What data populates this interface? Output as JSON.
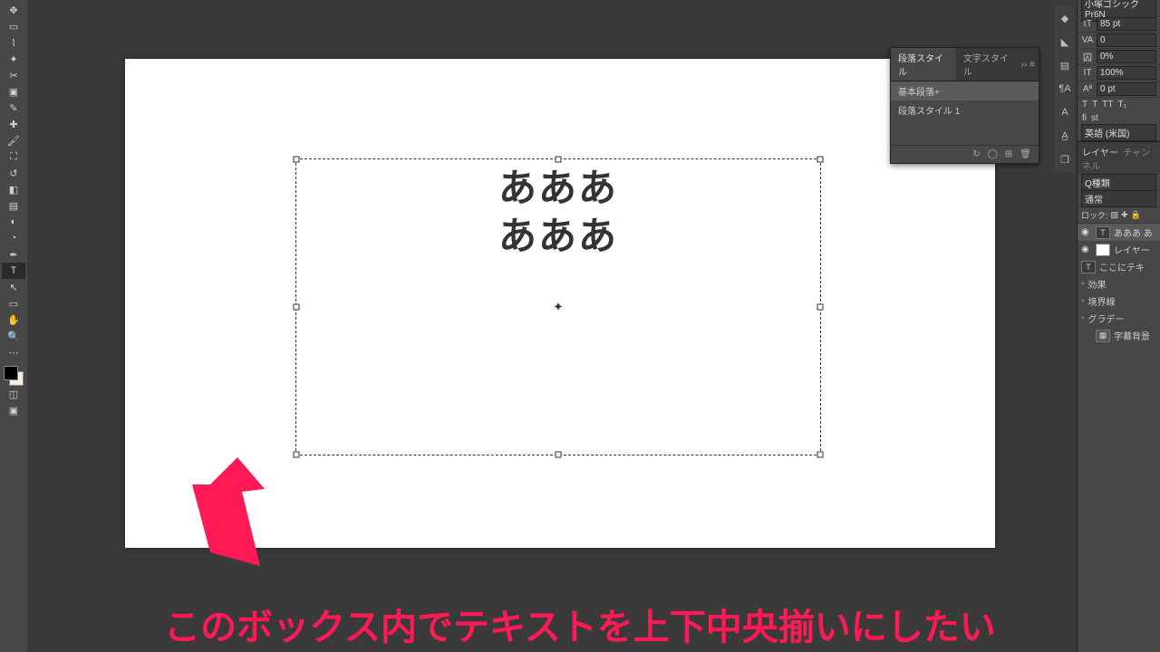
{
  "canvas": {
    "text_line1": "あああ",
    "text_line2": "あああ"
  },
  "paragraph_panel": {
    "tab1": "段落スタイル",
    "tab2": "文字スタイル",
    "item1": "基本段落+",
    "item2": "段落スタイル 1"
  },
  "char": {
    "font": "小塚ゴシック Pr6N",
    "size": "85 pt",
    "va": "0",
    "a_pct": "0%",
    "scale": "100%",
    "baseline": "0 pt",
    "lang": "英語 (米国)"
  },
  "type_row": {
    "T": "T",
    "T2": "T",
    "TT": "TT",
    "Tq": "T₁"
  },
  "fi_row": {
    "fi": "fi",
    "st": "st"
  },
  "layers": {
    "tab1": "レイヤー",
    "tab2": "チャンネル",
    "search": "Q種類",
    "mode": "通常",
    "lock_label": "ロック:",
    "l1": "あああ あ",
    "l2": "レイヤー",
    "sub1": "ここにテキ",
    "sub2": "効果",
    "sub3": "境界線",
    "sub4": "グラデー",
    "l3": "字幕背景"
  },
  "annotation": {
    "caption": "このボックス内でテキストを上下中央揃いにしたい"
  }
}
